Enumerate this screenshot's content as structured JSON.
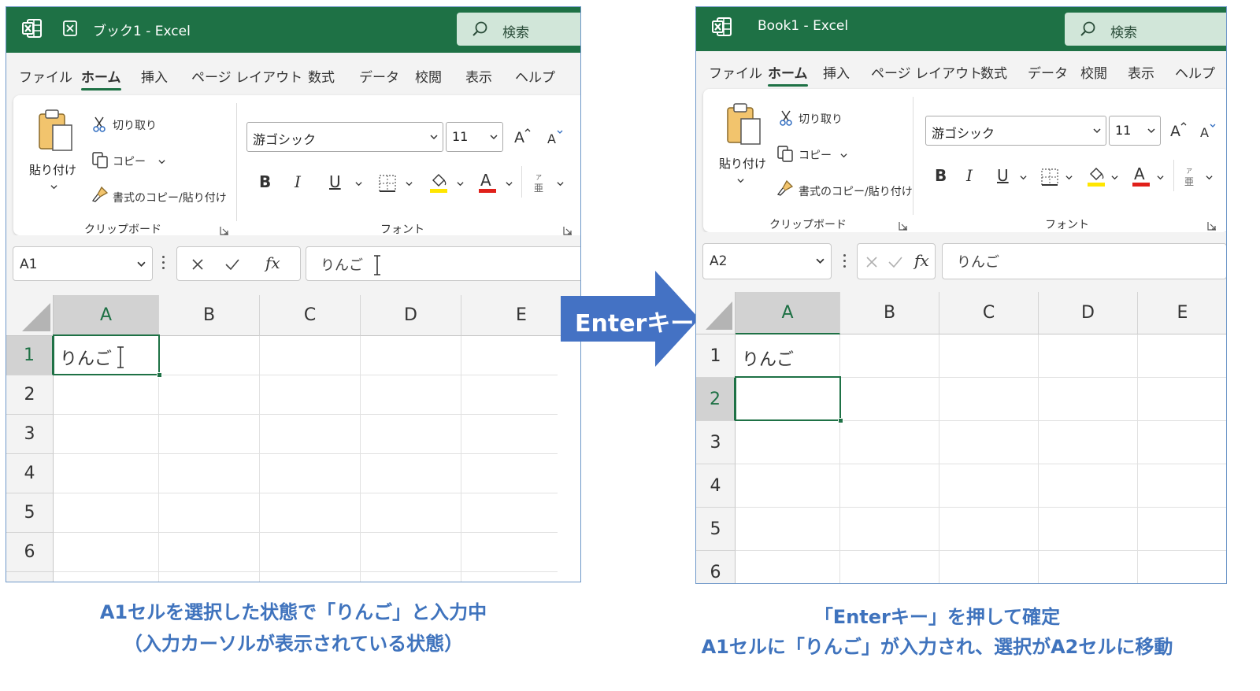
{
  "left": {
    "title": "ブック1 - Excel",
    "search": "検索",
    "menu": [
      "ファイル",
      "ホーム",
      "挿入",
      "ページ レイアウト",
      "数式",
      "データ",
      "校閲",
      "表示",
      "ヘルプ"
    ],
    "active_menu": "ホーム",
    "clipboard": {
      "paste": "貼り付け",
      "cut": "切り取り",
      "copy": "コピー",
      "format_painter": "書式のコピー/貼り付け",
      "group_label": "クリップボード"
    },
    "font": {
      "font_name": "游ゴシック",
      "font_size": "11",
      "bold": "B",
      "italic": "I",
      "underline": "U",
      "group_label": "フォント"
    },
    "name_box": "A1",
    "formula": "りんご",
    "columns": [
      "A",
      "B",
      "C",
      "D",
      "E"
    ],
    "rows": [
      "1",
      "2",
      "3",
      "4",
      "5",
      "6"
    ],
    "cell_a1": "りんご",
    "selected_cell": "A1"
  },
  "arrow_label": "Enterキー",
  "right": {
    "title": "Book1  -  Excel",
    "search": "検索",
    "menu": [
      "ファイル",
      "ホーム",
      "挿入",
      "ページ レイアウト",
      "数式",
      "データ",
      "校閲",
      "表示",
      "ヘルプ"
    ],
    "active_menu": "ホーム",
    "clipboard": {
      "paste": "貼り付け",
      "cut": "切り取り",
      "copy": "コピー",
      "format_painter": "書式のコピー/貼り付け",
      "group_label": "クリップボード"
    },
    "font": {
      "font_name": "游ゴシック",
      "font_size": "11",
      "bold": "B",
      "italic": "I",
      "underline": "U",
      "group_label": "フォント"
    },
    "name_box": "A2",
    "formula": "りんご",
    "columns": [
      "A",
      "B",
      "C",
      "D",
      "E"
    ],
    "rows": [
      "1",
      "2",
      "3",
      "4",
      "5",
      "6"
    ],
    "cell_a1": "りんご",
    "selected_cell": "A2"
  },
  "captions": {
    "left_line1": "A1セルを選択した状態で「りんご」と入力中",
    "left_line2": "（入力カーソルが表示されている状態）",
    "right_line1": "「Enterキー」を押して確定",
    "right_line2": "A1セルに「りんご」が入力され、選択がA2セルに移動"
  },
  "colors": {
    "excel_green": "#1e7145",
    "caption_blue": "#3f73bd",
    "arrow_blue": "#4472c4",
    "highlight_yellow": "#ffe600",
    "font_red": "#e0201a"
  },
  "icons": [
    "excel-logo-icon",
    "autosave-icon",
    "search-icon",
    "clipboard-icon",
    "scissors-icon",
    "copy-icon",
    "paintbrush-icon",
    "grow-font-icon",
    "shrink-font-icon",
    "borders-icon",
    "fill-color-icon",
    "font-color-icon",
    "phonetic-icon",
    "dialog-launcher-icon",
    "cancel-icon",
    "enter-icon",
    "fx-icon",
    "select-all-icon",
    "text-cursor-icon",
    "arrow-right-icon"
  ]
}
